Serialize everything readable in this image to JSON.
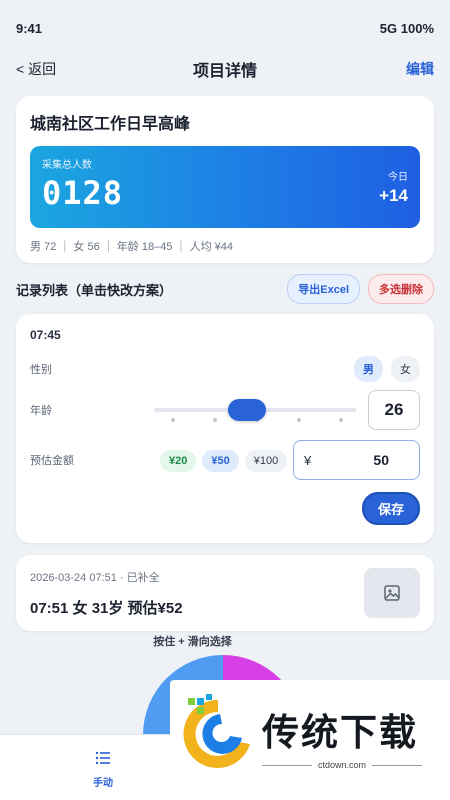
{
  "status_bar": {
    "time": "9:41",
    "network": "5G 100%"
  },
  "nav": {
    "back": "< 返回",
    "title": "项目详情",
    "edit": "编辑"
  },
  "project": {
    "name": "城南社区工作日早高峰",
    "stat_label": "采集总人数",
    "stat_value": "0128",
    "today_label": "今日",
    "today_value": "+14",
    "meta": "男 72 ｜ 女 56 ｜ 年龄 18–45 ｜ 人均 ¥44"
  },
  "list": {
    "title": "记录列表（单击快改方案）",
    "export_label": "导出Excel",
    "delete_label": "多选删除"
  },
  "edit": {
    "time": "07:45",
    "gender_label": "性别",
    "gender_options": [
      "男",
      "女"
    ],
    "gender_selected": "男",
    "age_label": "年龄",
    "age_value": "26",
    "age_slider_fraction": 0.45,
    "amount_label": "预估金额",
    "amount_options": [
      "¥20",
      "¥50",
      "¥100"
    ],
    "amount_selected": "¥50",
    "amount_prefix": "¥",
    "amount_value": "50",
    "save_label": "保存"
  },
  "record": {
    "meta": "2026-03-24 07:51 · 已补全",
    "main": "07:51 女 31岁 预估¥52"
  },
  "pie_hint": "按住 + 滑向选择",
  "pie_colors": {
    "left": "#4f9cf2",
    "right": "#d640e6",
    "bottom": "#f0b23a"
  },
  "tab": {
    "label": "手动"
  },
  "watermark": {
    "text": "传统下载",
    "sub": "ctdown.com"
  }
}
